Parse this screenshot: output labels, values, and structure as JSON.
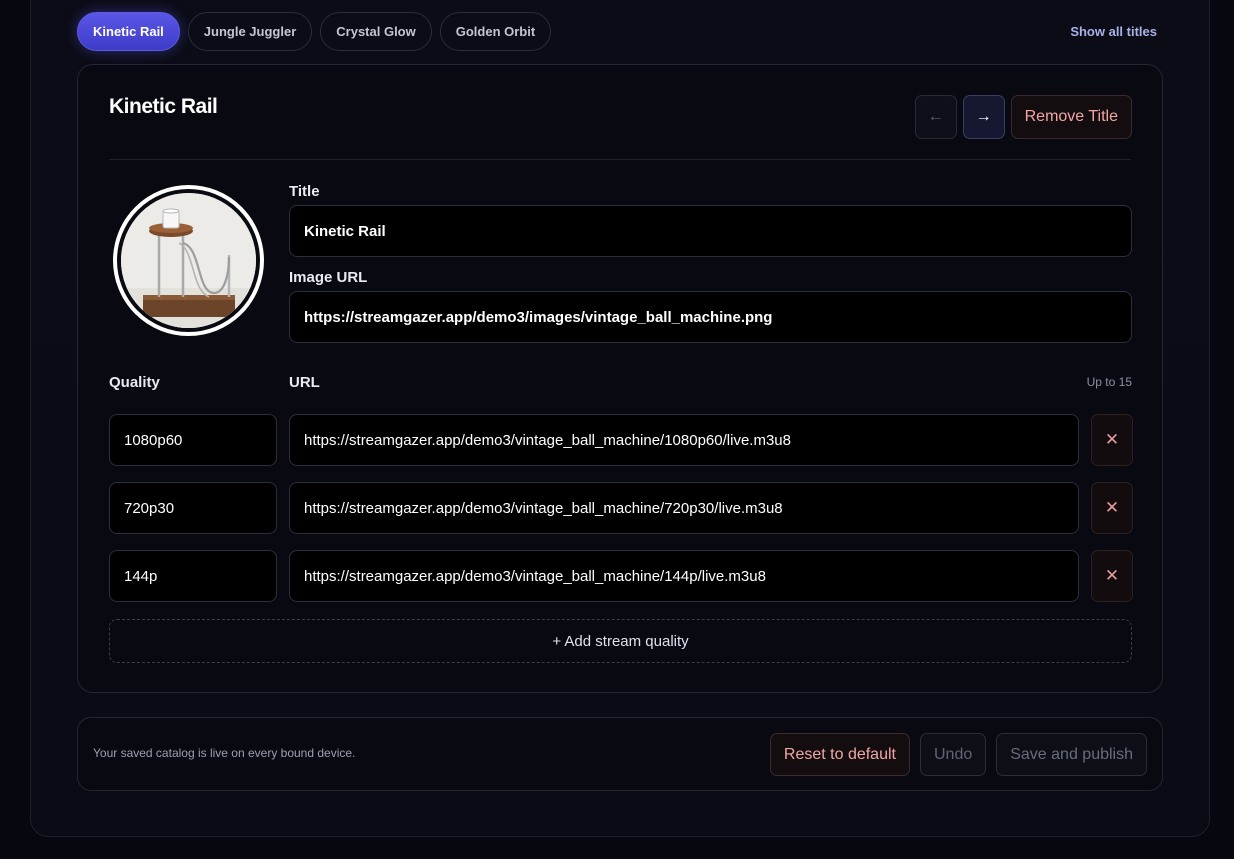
{
  "tabs": [
    {
      "label": "Kinetic Rail",
      "active": true
    },
    {
      "label": "Jungle Juggler",
      "active": false
    },
    {
      "label": "Crystal Glow",
      "active": false
    },
    {
      "label": "Golden Orbit",
      "active": false
    }
  ],
  "show_all_label": "Show all titles",
  "editor": {
    "heading": "Kinetic Rail",
    "prev_icon": "arrow-left-icon",
    "next_icon": "arrow-right-icon",
    "prev_glyph": "←",
    "next_glyph": "→",
    "remove_title_label": "Remove Title",
    "title_label": "Title",
    "title_value": "Kinetic Rail",
    "image_url_label": "Image URL",
    "image_url_value": "https://streamgazer.app/demo3/images/vintage_ball_machine.png",
    "quality_header": "Quality",
    "url_header": "URL",
    "limit_hint": "Up to 15",
    "streams": [
      {
        "quality": "1080p60",
        "url": "https://streamgazer.app/demo3/vintage_ball_machine/1080p60/live.m3u8"
      },
      {
        "quality": "720p30",
        "url": "https://streamgazer.app/demo3/vintage_ball_machine/720p30/live.m3u8"
      },
      {
        "quality": "144p",
        "url": "https://streamgazer.app/demo3/vintage_ball_machine/144p/live.m3u8"
      }
    ],
    "remove_row_glyph": "✕",
    "add_quality_label": "+ Add stream quality"
  },
  "footer": {
    "message": "Your saved catalog is live on every bound device.",
    "reset_label": "Reset to default",
    "undo_label": "Undo",
    "save_label": "Save and publish"
  },
  "colors": {
    "accent": "#4f4be0",
    "danger_text": "#f2a6a6",
    "background": "#07080f"
  }
}
